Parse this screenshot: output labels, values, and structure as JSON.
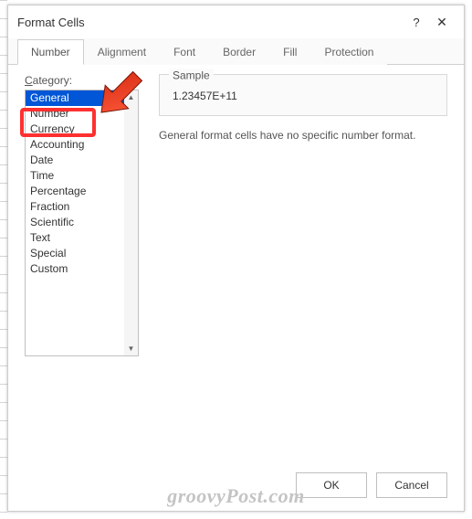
{
  "dialog": {
    "title": "Format Cells"
  },
  "tabs": {
    "items": [
      {
        "label": "Number"
      },
      {
        "label": "Alignment"
      },
      {
        "label": "Font"
      },
      {
        "label": "Border"
      },
      {
        "label": "Fill"
      },
      {
        "label": "Protection"
      }
    ]
  },
  "category": {
    "label_prefix": "C",
    "label_rest": "ategory:",
    "items": [
      {
        "label": "General",
        "selected": true
      },
      {
        "label": "Number"
      },
      {
        "label": "Currency"
      },
      {
        "label": "Accounting"
      },
      {
        "label": "Date"
      },
      {
        "label": "Time"
      },
      {
        "label": "Percentage"
      },
      {
        "label": "Fraction"
      },
      {
        "label": "Scientific"
      },
      {
        "label": "Text"
      },
      {
        "label": "Special"
      },
      {
        "label": "Custom"
      }
    ]
  },
  "sample": {
    "label": "Sample",
    "value": "1.23457E+11"
  },
  "description": "General format cells have no specific number format.",
  "buttons": {
    "ok": "OK",
    "cancel": "Cancel"
  },
  "watermark": "groovyPost.com",
  "titlebar_icons": {
    "help": "?",
    "close": "✕"
  }
}
